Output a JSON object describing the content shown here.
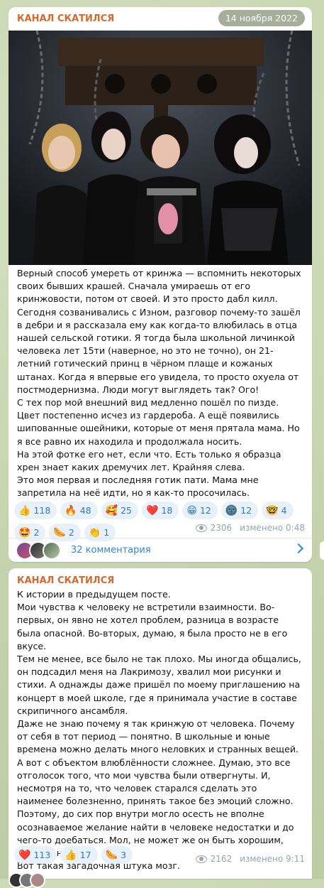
{
  "post1": {
    "channel": "КАНАЛ СКАТИЛСЯ",
    "date": "14 ноября 2022",
    "paragraphs": [
      "Верный способ умереть от кринжа — вспомнить некоторых своих бывших крашей. Сначала умираешь от его кринжовости, потом от своей. И это просто дабл килл.",
      "Сегодня созванивались с Изном, разговор почему-то зашёл в дебри и я рассказала ему как когда-то влюбилась в отца нашей сельской готики. Я тогда была школьной личинкой человека лет 15ти (наверное, но это не точно), он 21-летний готический принц в чёрном плаще и кожаных штанах. Когда я впервые его увидела, то просто охуела от постмодернизма. Люди могут выглядеть так? Ого!",
      "С тех пор мой внешний вид медленно пошёл по пизде. Цвет постепенно исчез из гардероба. А ещё появились шипованные ошейники, которые от меня прятала мама. Но я все равно их находила и продолжала носить.",
      "На этой фотке его нет, если что. Есть только я образца хрен знает каких дремучих лет. Крайняя слева.",
      "Это моя первая и последняя готик пати. Мама мне запретила на неё идти, но я как-то просочилась."
    ],
    "reactions": [
      {
        "emoji": "👍",
        "count": "118"
      },
      {
        "emoji": "🔥",
        "count": "48"
      },
      {
        "emoji": "🥰",
        "count": "25"
      },
      {
        "emoji": "❤️",
        "count": "18"
      },
      {
        "emoji": "😁",
        "count": "12"
      },
      {
        "emoji": "🌚",
        "count": "12"
      },
      {
        "emoji": "🤓",
        "count": "4"
      },
      {
        "emoji": "🤩",
        "count": "2"
      },
      {
        "emoji": "🌭",
        "count": "2"
      },
      {
        "emoji": "👏",
        "count": "1"
      }
    ],
    "views": "2306",
    "edited": "изменено 0:48",
    "comments_label": "32 комментария"
  },
  "post2": {
    "channel": "КАНАЛ СКАТИЛСЯ",
    "paragraphs": [
      "К истории в предыдущем посте.",
      "Мои чувства к человеку не встретили взаимности. Во-первых, он явно не хотел проблем, разница в возрасте была опасной. Во-вторых, думаю, я была просто не в его вкусе.",
      "Тем не менее, все было не так плохо. Мы иногда общались, он подсадил меня на Лакримозу, хвалил мои рисунки и стихи. А однажды даже пришёл по моему приглашению на концерт в моей школе, где я принимала участие в составе скрипичного ансамбля.",
      "Даже не знаю почему я так кринжую от человека. Почему от себя в тот период — понятно. В школьные и юные времена можно делать много неловких и странных вещей.",
      "А вот с объектом влюблённости сложнее. Думаю, это все отголосок того, что мои чувства были отвергнуты. И, несмотря на то, что человек старался сделать это наименее болезненно, принять такое без эмоций сложно. Поэтому, до сих пор внутри могло осесть не вполне осознаваемое желание найти в человеке недостатки и до чего-то доебаться. Мол, не может же он быть хорошим, сказав «нет».",
      "Вот такая загадочная штука мозг."
    ],
    "reactions": [
      {
        "emoji": "❤️",
        "count": "113"
      },
      {
        "emoji": "👍",
        "count": "17"
      },
      {
        "emoji": "🌭",
        "count": "3"
      }
    ],
    "views": "2162",
    "edited": "изменено 9:11"
  }
}
